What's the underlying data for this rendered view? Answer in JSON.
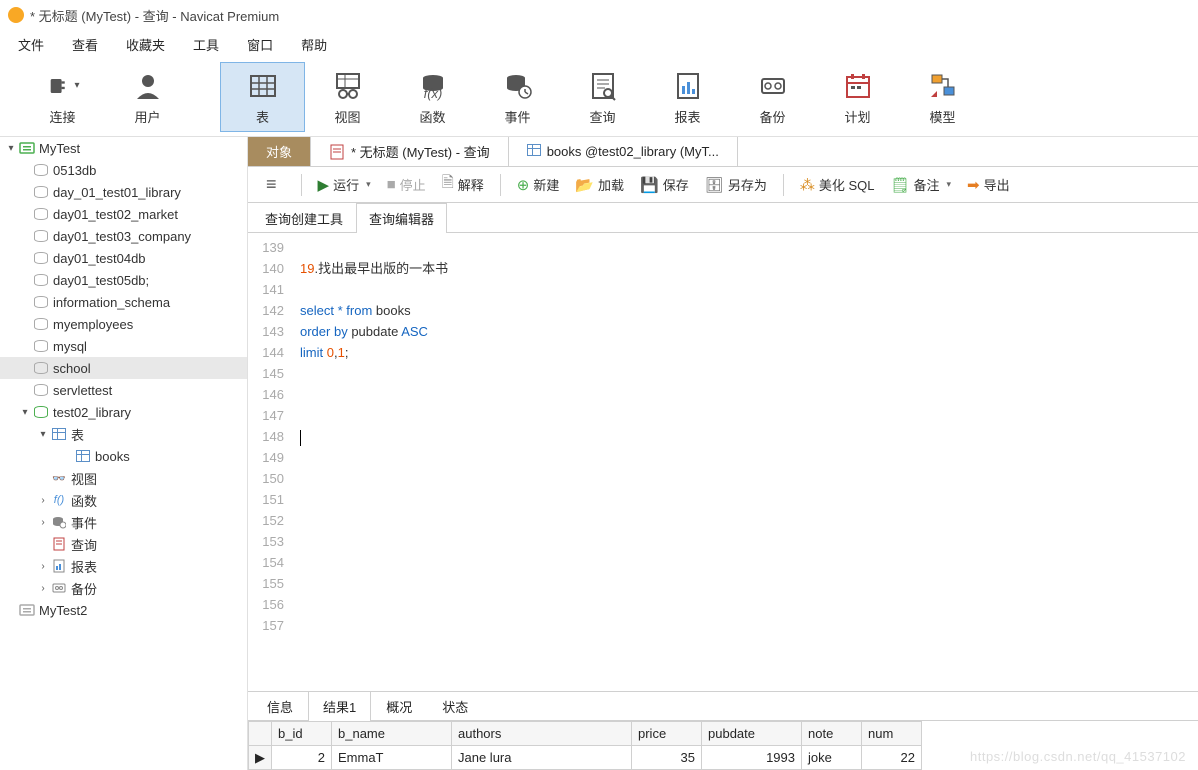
{
  "window": {
    "title": "* 无标题 (MyTest) - 查询 - Navicat Premium"
  },
  "menu": {
    "file": "文件",
    "view": "查看",
    "favorites": "收藏夹",
    "tools": "工具",
    "window": "窗口",
    "help": "帮助"
  },
  "bigToolbar": {
    "connect": "连接",
    "users": "用户",
    "table": "表",
    "view": "视图",
    "function": "函数",
    "event": "事件",
    "query": "查询",
    "report": "报表",
    "backup": "备份",
    "plan": "计划",
    "model": "模型"
  },
  "tree": {
    "conn1": "MyTest",
    "dbs": [
      "0513db",
      "day_01_test01_library",
      "day01_test02_market",
      "day01_test03_company",
      "day01_test04db",
      "day01_test05db;",
      "information_schema",
      "myemployees",
      "mysql",
      "school",
      "servlettest",
      "test02_library"
    ],
    "tables_label": "表",
    "books": "books",
    "views_label": "视图",
    "functions_label": "函数",
    "events_label": "事件",
    "queries_label": "查询",
    "reports_label": "报表",
    "backups_label": "备份",
    "conn2": "MyTest2"
  },
  "docTabs": {
    "objects": "对象",
    "tab1": "* 无标题 (MyTest) - 查询",
    "tab2": "books @test02_library (MyT..."
  },
  "queryToolbar": {
    "run": "运行",
    "stop": "停止",
    "explain": "解释",
    "new": "新建",
    "load": "加载",
    "save": "保存",
    "saveas": "另存为",
    "beautify": "美化 SQL",
    "note": "备注",
    "export": "导出"
  },
  "subTabs": {
    "builder": "查询创建工具",
    "editor": "查询编辑器"
  },
  "editor": {
    "startLine": 139,
    "lines": [
      "",
      "19.找出最早出版的一本书",
      "",
      "select * from books",
      "order by pubdate ASC",
      "limit 0,1;",
      "",
      "",
      "",
      "|",
      "",
      "",
      "",
      "",
      "",
      "",
      "",
      "",
      ""
    ]
  },
  "resultTabs": {
    "info": "信息",
    "result1": "结果1",
    "profile": "概况",
    "status": "状态"
  },
  "resultGrid": {
    "columns": [
      "b_id",
      "b_name",
      "authors",
      "price",
      "pubdate",
      "note",
      "num"
    ],
    "rows": [
      {
        "b_id": "2",
        "b_name": "EmmaT",
        "authors": "Jane lura",
        "price": "35",
        "pubdate": "1993",
        "note": "joke",
        "num": "22"
      }
    ]
  },
  "watermark": "https://blog.csdn.net/qq_41537102"
}
